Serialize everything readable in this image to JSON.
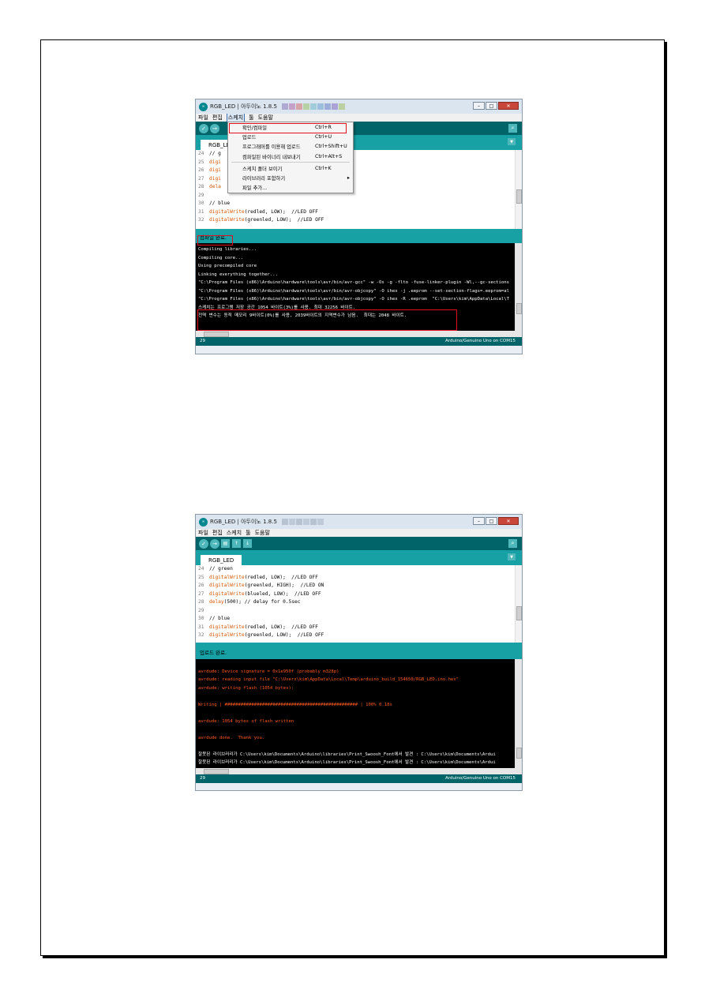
{
  "window1": {
    "title": "RGB_LED | 아두이노 1.8.5",
    "menu": [
      "파일",
      "편집",
      "스케치",
      "툴",
      "도움말"
    ],
    "tab": "RGB_LED",
    "dropdown": [
      {
        "label": "확인/컴파일",
        "shortcut": "Ctrl+R"
      },
      {
        "label": "업로드",
        "shortcut": "Ctrl+U"
      },
      {
        "label": "프로그래머를 이용해 업로드",
        "shortcut": "Ctrl+Shift+U"
      },
      {
        "label": "컴파일된 바이너리 내보내기",
        "shortcut": "Ctrl+Alt+S"
      },
      {
        "label": "스케치 폴더 보이기",
        "shortcut": "Ctrl+K"
      },
      {
        "label": "라이브러리 포함하기",
        "shortcut": ""
      },
      {
        "label": "파일 추가...",
        "shortcut": ""
      }
    ],
    "code": [
      {
        "n": "24",
        "t": "// g"
      },
      {
        "n": "25",
        "t": "digi"
      },
      {
        "n": "26",
        "t": "digi"
      },
      {
        "n": "27",
        "t": "digi"
      },
      {
        "n": "28",
        "t": "dela"
      },
      {
        "n": "29",
        "t": ""
      },
      {
        "n": "30",
        "t": "// blue"
      },
      {
        "n": "31",
        "t": "digitalWrite(redled, LOW);  //LED OFF"
      },
      {
        "n": "32",
        "t": "digitalWrite(greenled, LOW);  //LED OFF"
      }
    ],
    "status": "컴파일 완료.",
    "console": [
      "Compiling libraries...",
      "Compiling core...",
      "Using precompiled core",
      "Linking everything together...",
      "\"C:\\Program Files (x86)\\Arduino\\hardware\\tools\\avr/bin/avr-gcc\" -w -Os -g -flto -fuse-linker-plugin -Wl,--gc-sections",
      "\"C:\\Program Files (x86)\\Arduino\\hardware\\tools\\avr/bin/avr-objcopy\" -O ihex -j .eeprom --set-section-flags=.eeprom=al",
      "\"C:\\Program Files (x86)\\Arduino\\hardware\\tools\\avr/bin/avr-objcopy\" -O ihex -R .eeprom  \"C:\\Users\\kim\\AppData\\Local\\T",
      "스케치는 프로그램 저장 공간 1054 바이트(3%)를 사용. 최대 32256 바이트.",
      "전역 변수는 동적 메모리 9바이트(0%)를 사용, 2039바이트의 지역변수가 남음.  최대는 2048 바이트."
    ],
    "footer_line": "29",
    "footer_board": "Arduino/Genuino Uno on COM15"
  },
  "window2": {
    "title": "RGB_LED | 아두이노 1.8.5",
    "menu": [
      "파일",
      "편집",
      "스케치",
      "툴",
      "도움말"
    ],
    "tab": "RGB_LED",
    "code": [
      {
        "n": "24",
        "t": "// green"
      },
      {
        "n": "25",
        "t": "digitalWrite(redled, LOW);  //LED OFF"
      },
      {
        "n": "26",
        "t": "digitalWrite(greenled, HIGH);  //LED ON"
      },
      {
        "n": "27",
        "t": "digitalWrite(blueled, LOW);  //LED OFF"
      },
      {
        "n": "28",
        "t": "delay(500); // delay for 0.5sec"
      },
      {
        "n": "29",
        "t": ""
      },
      {
        "n": "30",
        "t": "// blue"
      },
      {
        "n": "31",
        "t": "digitalWrite(redled, LOW);  //LED OFF"
      },
      {
        "n": "32",
        "t": "digitalWrite(greenled, LOW);  //LED OFF"
      }
    ],
    "status": "업로드 완료.",
    "console": [
      "",
      "avrdude: Device signature = 0x1e950f (probably m328p)",
      "avrdude: reading input file \"C:\\Users\\kim\\AppData\\Local\\Temp\\arduino_build_154650/RGB_LED.ino.hex\"",
      "avrdude: writing flash (1054 bytes):",
      "",
      "Writing | ################################################## | 100% 0.18s",
      "",
      "avrdude: 1054 bytes of flash written",
      "",
      "avrdude done.  Thank you.",
      "",
      "잘못된 라이브러리가 C:\\Users\\kim\\Documents\\Arduino\\libraries\\Print_Swoosh_Font에서 발견 : C:\\Users\\kim\\Documents\\Ardui",
      "잘못된 라이브러리가 C:\\Users\\kim\\Documents\\Arduino\\libraries\\Print_Swoosh_Font에서 발견 : C:\\Users\\kim\\Documents\\Ardui"
    ],
    "footer_line": "29",
    "footer_board": "Arduino/Genuino Uno on COM15"
  }
}
